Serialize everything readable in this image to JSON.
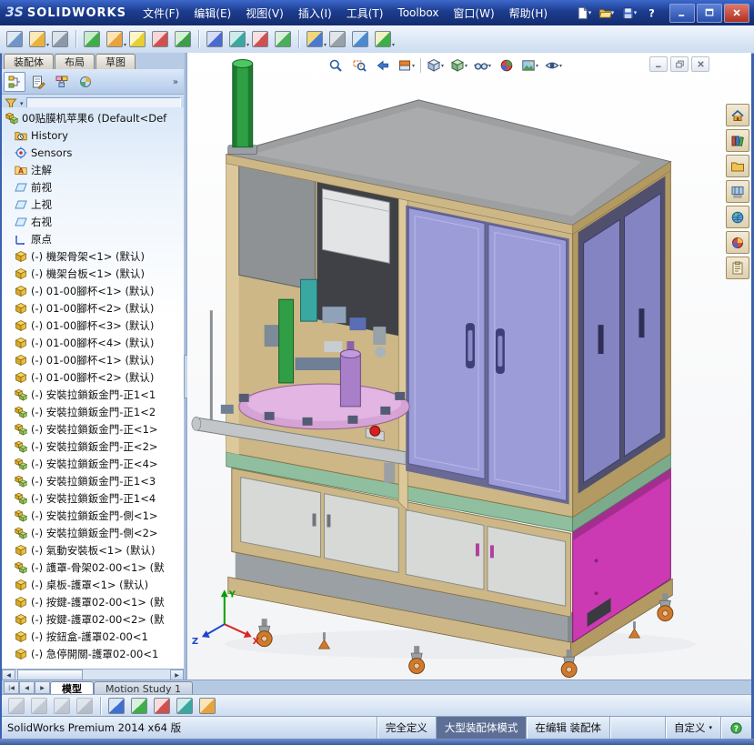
{
  "title_bar": {
    "brand_prefix": "3S",
    "brand": "SOLIDWORKS",
    "menus": [
      {
        "name": "menu-file",
        "label": "文件(F)"
      },
      {
        "name": "menu-edit",
        "label": "编辑(E)"
      },
      {
        "name": "menu-view",
        "label": "视图(V)"
      },
      {
        "name": "menu-insert",
        "label": "插入(I)"
      },
      {
        "name": "menu-tools",
        "label": "工具(T)"
      },
      {
        "name": "menu-toolbox",
        "label": "Toolbox"
      },
      {
        "name": "menu-window",
        "label": "窗口(W)"
      },
      {
        "name": "menu-help",
        "label": "帮助(H)"
      }
    ],
    "quick": [
      {
        "name": "new-document-icon",
        "icon": "new-doc",
        "dropdown": true
      },
      {
        "name": "open-document-icon",
        "icon": "open-folder",
        "dropdown": true
      },
      {
        "name": "save-document-icon",
        "icon": "save-disk",
        "dropdown": true
      },
      {
        "name": "help-icon",
        "icon": "help-q"
      }
    ],
    "window_controls": [
      {
        "name": "minimize-button",
        "icon": "win-min"
      },
      {
        "name": "maximize-button",
        "icon": "win-max"
      },
      {
        "name": "close-button",
        "icon": "win-close"
      }
    ]
  },
  "ui_glyphs": {
    "dropdown": "▾",
    "left": "◀",
    "right": "▶",
    "collapse": "◀",
    "overflow": "»"
  },
  "main_toolbar": [
    {
      "name": "insert-components-icon",
      "c1": "#6f96c8",
      "c2": "#dfe9f5"
    },
    {
      "name": "open-recent-icon",
      "c1": "#e8b23c",
      "c2": "#fbe9b8",
      "dropdown": true
    },
    {
      "name": "attachments-icon",
      "c1": "#8a98a8",
      "c2": "#dde3ea",
      "sep_after": true
    },
    {
      "name": "linear-component-pattern-icon",
      "c1": "#3fae49",
      "c2": "#c9ecca"
    },
    {
      "name": "smart-fasteners-icon",
      "c1": "#e8a33c",
      "c2": "#fce4b8",
      "dropdown": true
    },
    {
      "name": "assembly-features-icon",
      "c1": "#e8cf30",
      "c2": "#fdf6c8"
    },
    {
      "name": "mate-icon",
      "c1": "#d05050",
      "c2": "#f6d6d6"
    },
    {
      "name": "move-component-icon",
      "c1": "#3f9e49",
      "c2": "#d4f0d6",
      "sep_after": true
    },
    {
      "name": "external-references-icon",
      "c1": "#4a6ad0",
      "c2": "#d4ddf8"
    },
    {
      "name": "reference-geometry-icon",
      "c1": "#3aa8a0",
      "c2": "#cdecea",
      "dropdown": true
    },
    {
      "name": "interference-detection-icon",
      "c1": "#d05050",
      "c2": "#f8e0e0"
    },
    {
      "name": "bill-of-materials-icon",
      "c1": "#4aae5a",
      "c2": "#daf0dd",
      "sep_after": true
    },
    {
      "name": "exploded-view-icon",
      "c1": "#4a7ad0",
      "c2": "#f0d878",
      "dropdown": true
    },
    {
      "name": "explode-line-sketch-icon",
      "c1": "#98a0a8",
      "c2": "#e2e6ea"
    },
    {
      "name": "edit-component-icon",
      "c1": "#4a8ad0",
      "c2": "#d8e8f8"
    },
    {
      "name": "new-motion-study-icon",
      "c1": "#3fae49",
      "c2": "#eef2c4",
      "dropdown": true
    }
  ],
  "command_tabs": [
    {
      "name": "tab-assembly",
      "label": "装配体"
    },
    {
      "name": "tab-layout",
      "label": "布局"
    },
    {
      "name": "tab-sketch",
      "label": "草图"
    }
  ],
  "panel_tabs": [
    {
      "name": "featuremanager-tab",
      "icon": "fm-tree",
      "active": true
    },
    {
      "name": "propertymanager-tab",
      "icon": "prop-mgr"
    },
    {
      "name": "configurationmanager-tab",
      "icon": "config-mgr"
    },
    {
      "name": "displaymanager-tab",
      "icon": "display-mgr"
    }
  ],
  "tree": {
    "root": {
      "icon": "assembly",
      "label": "00贴膜机苹果6 (Default<Def"
    },
    "items": [
      {
        "icon": "history",
        "label": "History"
      },
      {
        "icon": "sensors",
        "label": "Sensors"
      },
      {
        "icon": "annotations",
        "label": "注解"
      },
      {
        "icon": "plane",
        "label": "前视"
      },
      {
        "icon": "plane",
        "label": "上视"
      },
      {
        "icon": "plane",
        "label": "右视"
      },
      {
        "icon": "origin",
        "label": "原点"
      },
      {
        "icon": "part",
        "label": "(-) 機架骨架<1> (默认)"
      },
      {
        "icon": "part",
        "label": "(-) 機架台板<1> (默认)"
      },
      {
        "icon": "part",
        "label": "(-) 01-00腳杯<1> (默认)"
      },
      {
        "icon": "part",
        "label": "(-) 01-00腳杯<2> (默认)"
      },
      {
        "icon": "part",
        "label": "(-) 01-00腳杯<3> (默认)"
      },
      {
        "icon": "part",
        "label": "(-) 01-00腳杯<4> (默认)"
      },
      {
        "icon": "part",
        "label": "(-) 01-00腳杯<1> (默认)"
      },
      {
        "icon": "part",
        "label": "(-) 01-00腳杯<2> (默认)"
      },
      {
        "icon": "assembly",
        "label": "(-) 安裝拉鎖鈑金門-正1<1"
      },
      {
        "icon": "assembly",
        "label": "(-) 安裝拉鎖鈑金門-正1<2"
      },
      {
        "icon": "assembly",
        "label": "(-) 安裝拉鎖鈑金門-正<1>"
      },
      {
        "icon": "assembly",
        "label": "(-) 安裝拉鎖鈑金門-正<2>"
      },
      {
        "icon": "assembly",
        "label": "(-) 安裝拉鎖鈑金門-正<4>"
      },
      {
        "icon": "assembly",
        "label": "(-) 安裝拉鎖鈑金門-正1<3"
      },
      {
        "icon": "assembly",
        "label": "(-) 安裝拉鎖鈑金門-正1<4"
      },
      {
        "icon": "assembly",
        "label": "(-) 安裝拉鎖鈑金門-側<1>"
      },
      {
        "icon": "assembly",
        "label": "(-) 安裝拉鎖鈑金門-側<2>"
      },
      {
        "icon": "part",
        "label": "(-) 氣動安裝板<1> (默认)"
      },
      {
        "icon": "assembly",
        "label": "(-) 護罩-骨架02-00<1> (默"
      },
      {
        "icon": "part",
        "label": "(-) 桌板-護罩<1> (默认)"
      },
      {
        "icon": "part",
        "label": "(-) 按鍵-護罩02-00<1> (默"
      },
      {
        "icon": "part",
        "label": "(-) 按鍵-護罩02-00<2> (默"
      },
      {
        "icon": "part",
        "label": "(-) 按鈕盒-護罩02-00<1"
      },
      {
        "icon": "part",
        "label": "(-) 急停開關-護罩02-00<1"
      }
    ]
  },
  "headsup": [
    {
      "name": "zoom-to-fit-icon",
      "icon": "zoom-fit"
    },
    {
      "name": "zoom-to-area-icon",
      "icon": "zoom-area"
    },
    {
      "name": "previous-view-icon",
      "icon": "prev-view"
    },
    {
      "name": "section-view-icon",
      "icon": "section-view",
      "dropdown": true
    },
    {
      "sep": true
    },
    {
      "name": "view-orientation-icon",
      "icon": "view-cube",
      "dropdown": true
    },
    {
      "name": "display-style-icon",
      "icon": "display-style",
      "dropdown": true
    },
    {
      "name": "hide-show-items-icon",
      "icon": "glasses",
      "dropdown": true
    },
    {
      "name": "edit-appearance-icon",
      "icon": "appearance-ball"
    },
    {
      "name": "apply-scene-icon",
      "icon": "scene",
      "dropdown": true
    },
    {
      "name": "view-settings-icon",
      "icon": "eye",
      "dropdown": true
    }
  ],
  "doc_controls": [
    {
      "name": "document-minimize-button",
      "icon": "win-min"
    },
    {
      "name": "document-restore-button",
      "icon": "win-restore"
    },
    {
      "name": "document-close-button",
      "icon": "win-close"
    }
  ],
  "task_pane": [
    {
      "name": "solidworks-resources-icon",
      "icon": "home"
    },
    {
      "name": "design-library-icon",
      "icon": "library"
    },
    {
      "name": "file-explorer-icon",
      "icon": "folder"
    },
    {
      "name": "view-palette-icon",
      "icon": "palette"
    },
    {
      "name": "solidworks-forum-icon",
      "icon": "globe"
    },
    {
      "name": "appearances-scenes-icon",
      "icon": "appearance"
    },
    {
      "name": "custom-properties-icon",
      "icon": "props"
    }
  ],
  "bottom_tabs": {
    "nav": [
      {
        "name": "tab-scroll-first-button",
        "glyph": "|◀"
      },
      {
        "name": "tab-scroll-left-button",
        "glyph": "◀"
      },
      {
        "name": "tab-scroll-right-button",
        "glyph": "▶"
      }
    ],
    "tabs": [
      {
        "name": "tab-model",
        "label": "模型",
        "active": true
      },
      {
        "name": "tab-motion-study-1",
        "label": "Motion Study 1",
        "active": false
      }
    ]
  },
  "bottom_toolbar": [
    {
      "name": "filter-vertices-icon",
      "c1": "#9aa5ad",
      "c2": "#e2e7eb",
      "disabled": true
    },
    {
      "name": "filter-edges-icon",
      "c1": "#9aa5ad",
      "c2": "#e2e7eb",
      "disabled": true
    },
    {
      "name": "filter-faces-icon",
      "c1": "#9aa5ad",
      "c2": "#e2e7eb",
      "disabled": true
    },
    {
      "name": "toggle-selection-filter-icon",
      "c1": "#8890a0",
      "c2": "#d9dee5",
      "disabled": true,
      "sep_after": true
    },
    {
      "name": "quick-snaps-icon",
      "c1": "#3f6fd0",
      "c2": "#d9e5f8"
    },
    {
      "name": "magnified-selection-icon",
      "c1": "#3fae49",
      "c2": "#d9f0dd"
    },
    {
      "name": "box-selection-icon",
      "c1": "#d05050",
      "c2": "#f8dcdc"
    },
    {
      "name": "lasso-selection-icon",
      "c1": "#3aa8a0",
      "c2": "#d2eceb"
    },
    {
      "name": "select-over-geometry-icon",
      "c1": "#e8a33c",
      "c2": "#fce4b8"
    }
  ],
  "status_bar": {
    "product": "SolidWorks Premium 2014 x64 版",
    "segments": [
      {
        "name": "status-definition",
        "label": "完全定义"
      },
      {
        "name": "status-large-assembly-mode",
        "label": "大型装配体模式",
        "active": true
      },
      {
        "name": "status-editing-state",
        "label": "在编辑 装配体"
      },
      {
        "name": "status-spare",
        "label": ""
      },
      {
        "name": "status-unit-system",
        "label": "自定义",
        "dropdown": true
      },
      {
        "name": "status-help-icon",
        "icon": "help-green"
      }
    ]
  },
  "model": {
    "triad": {
      "x": "X",
      "y": "Y",
      "z": "Z"
    },
    "colors": {
      "frame_tan": "#cdb787",
      "frame_tan_dark": "#b29a62",
      "top_gray": "#9d9fa0",
      "panel_gray": "#8e9294",
      "door_lavender": "#9c9cd9",
      "door_lavender_dark": "#8484c2",
      "recess_dark": "#50506e",
      "panel_magenta": "#cb3ab2",
      "table_green": "#8fbf9f",
      "cabinet_gray": "#d7d9d6",
      "caster_orange": "#cf7a2e",
      "cylinder_green": "#2ea043",
      "disc_pink": "#d5a3d6",
      "hub_purple": "#a87fc8",
      "triad_x": "#dd2222",
      "triad_y": "#00a000",
      "triad_z": "#2244cc"
    }
  }
}
